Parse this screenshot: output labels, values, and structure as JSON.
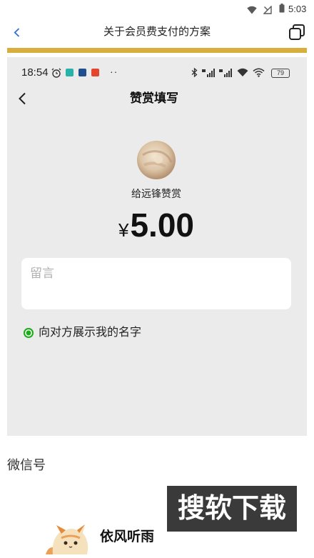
{
  "device_status": {
    "time": "5:03",
    "icons": [
      "wifi-icon",
      "signal-off-icon",
      "battery-icon"
    ]
  },
  "header": {
    "back_icon": "chevron-left-icon",
    "title": "关于会员费支付的方案",
    "action_icon": "copy-icon"
  },
  "colors": {
    "accent_bar": "#d8ae3f",
    "link_blue": "#2f6fd6",
    "check_green": "#1aad19",
    "embedded_bg": "#ebebeb",
    "watermark_bg": "#3a3a3a"
  },
  "embedded": {
    "status": {
      "time": "18:54",
      "more_indicator": "··",
      "battery": "79",
      "icons": [
        "alarm-icon",
        "app-icon",
        "bluetooth-icon",
        "signal-icon",
        "wifi-icon",
        "battery-icon"
      ]
    },
    "nav": {
      "back_icon": "chevron-left-icon",
      "title": "赞赏填写"
    },
    "recipient": "给远锋赞赏",
    "amount": {
      "currency": "¥",
      "value": "5.00"
    },
    "message": {
      "placeholder": "留言"
    },
    "show_name": {
      "label": "向对方展示我的名字",
      "checked": true
    }
  },
  "article": {
    "wechat_id_label": "微信号",
    "author_name": "依风听雨"
  },
  "watermark": "搜软下载"
}
